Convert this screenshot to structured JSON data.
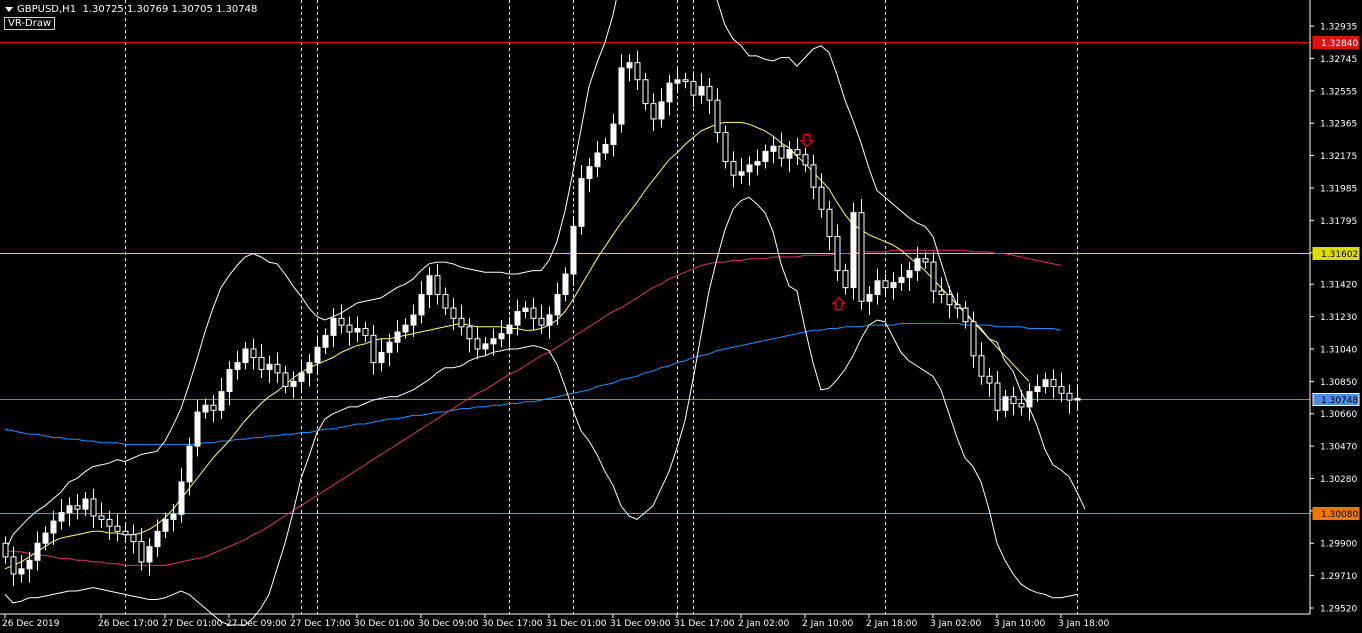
{
  "header": {
    "symbol": "GBPUSD,H1",
    "ohlc": "1.30725 1.30769 1.30705 1.30748",
    "indicator_label": "VR-Draw"
  },
  "colors": {
    "background": "#000000",
    "bull_candle": "#ffffff",
    "bear_candle": "#000000",
    "candle_wick": "#ffffff",
    "bb_line": "#ffffff",
    "ma_yellow": "#ffff66",
    "ma_pink": "#dd3366",
    "ma_blue": "#1e90ff",
    "red_level": "#dd1111",
    "yellow_level": "#dddd00",
    "blue_level": "#4a90e2",
    "orange_level": "#ee7700",
    "arrow": "#dd0000",
    "grid": "#ffffff"
  },
  "chart_data": {
    "type": "candlestick",
    "symbol": "GBPUSD",
    "timeframe": "H1",
    "ylim": [
      1.2952,
      1.33
    ],
    "y_ticks": [
      "1.32935",
      "1.32745",
      "1.32555",
      "1.32365",
      "1.32175",
      "1.31985",
      "1.31795",
      "1.31605",
      "1.31420",
      "1.31230",
      "1.31040",
      "1.30850",
      "1.30660",
      "1.30470",
      "1.30280",
      "1.30090",
      "1.29900",
      "1.29710",
      "1.29520"
    ],
    "x_labels": [
      {
        "bar": 0,
        "label": "26 Dec 2019"
      },
      {
        "bar": 12,
        "label": "26 Dec 17:00"
      },
      {
        "bar": 20,
        "label": "27 Dec 01:00"
      },
      {
        "bar": 28,
        "label": "27 Dec 09:00"
      },
      {
        "bar": 36,
        "label": "27 Dec 17:00"
      },
      {
        "bar": 44,
        "label": "30 Dec 01:00"
      },
      {
        "bar": 52,
        "label": "30 Dec 09:00"
      },
      {
        "bar": 60,
        "label": "30 Dec 17:00"
      },
      {
        "bar": 68,
        "label": "31 Dec 01:00"
      },
      {
        "bar": 76,
        "label": "31 Dec 09:00"
      },
      {
        "bar": 84,
        "label": "31 Dec 17:00"
      },
      {
        "bar": 92,
        "label": "2 Jan 02:00"
      },
      {
        "bar": 100,
        "label": "2 Jan 10:00"
      },
      {
        "bar": 108,
        "label": "2 Jan 18:00"
      },
      {
        "bar": 116,
        "label": "3 Jan 02:00"
      },
      {
        "bar": 124,
        "label": "3 Jan 10:00"
      },
      {
        "bar": 132,
        "label": "3 Jan 18:00"
      }
    ],
    "vlines": [
      15,
      37,
      39,
      63,
      71,
      84,
      86,
      110,
      134
    ],
    "closes": [
      1.2982,
      1.2972,
      1.2975,
      1.298,
      1.299,
      1.2996,
      1.3003,
      1.3008,
      1.3012,
      1.301,
      1.3016,
      1.3006,
      1.3004,
      1.3,
      1.2997,
      1.2995,
      1.2991,
      1.2979,
      1.2988,
      1.2997,
      1.3004,
      1.3007,
      1.3026,
      1.3047,
      1.3067,
      1.3071,
      1.3068,
      1.3079,
      1.3092,
      1.3096,
      1.3104,
      1.3099,
      1.3092,
      1.3095,
      1.309,
      1.3082,
      1.3085,
      1.309,
      1.3096,
      1.3105,
      1.3112,
      1.3122,
      1.3118,
      1.3114,
      1.3116,
      1.3112,
      1.3096,
      1.3102,
      1.3108,
      1.3114,
      1.3118,
      1.3124,
      1.3136,
      1.3147,
      1.3136,
      1.3128,
      1.3122,
      1.3117,
      1.311,
      1.3104,
      1.3107,
      1.311,
      1.3113,
      1.3118,
      1.3126,
      1.3128,
      1.3122,
      1.3118,
      1.3124,
      1.3136,
      1.3148,
      1.3176,
      1.3204,
      1.3211,
      1.3219,
      1.3224,
      1.3236,
      1.3269,
      1.3272,
      1.3262,
      1.3248,
      1.3239,
      1.3249,
      1.326,
      1.3262,
      1.3261,
      1.3253,
      1.3258,
      1.325,
      1.3231,
      1.3214,
      1.3206,
      1.3208,
      1.3212,
      1.3214,
      1.322,
      1.3223,
      1.3216,
      1.3221,
      1.3218,
      1.3212,
      1.3199,
      1.3186,
      1.317,
      1.315,
      1.314,
      1.3184,
      1.3132,
      1.3136,
      1.3144,
      1.314,
      1.3143,
      1.3146,
      1.315,
      1.3157,
      1.3155,
      1.3138,
      1.3136,
      1.313,
      1.3128,
      1.312,
      1.31,
      1.3088,
      1.3084,
      1.3068,
      1.3076,
      1.3072,
      1.307,
      1.3079,
      1.3082,
      1.3086,
      1.3082,
      1.3078,
      1.3074,
      1.3075
    ],
    "bb_upper": [
      1.2985,
      1.2995,
      1.3,
      1.3005,
      1.3009,
      1.3012,
      1.3016,
      1.302,
      1.3026,
      1.3028,
      1.3032,
      1.3035,
      1.3036,
      1.3037,
      1.3039,
      1.3038,
      1.304,
      1.3042,
      1.3043,
      1.3044,
      1.305,
      1.3059,
      1.3069,
      1.3083,
      1.3098,
      1.3114,
      1.3128,
      1.314,
      1.3147,
      1.3153,
      1.3158,
      1.316,
      1.3158,
      1.3155,
      1.3154,
      1.3148,
      1.3141,
      1.3135,
      1.3128,
      1.3123,
      1.3121,
      1.3123,
      1.3125,
      1.3128,
      1.3131,
      1.3132,
      1.3133,
      1.3134,
      1.3137,
      1.314,
      1.3142,
      1.3145,
      1.315,
      1.3154,
      1.3155,
      1.3155,
      1.3154,
      1.3152,
      1.3151,
      1.315,
      1.3149,
      1.3149,
      1.3149,
      1.3148,
      1.3148,
      1.3149,
      1.315,
      1.315,
      1.3156,
      1.3167,
      1.3185,
      1.3208,
      1.3233,
      1.3258,
      1.3272,
      1.3284,
      1.33,
      1.3322,
      1.3333,
      1.3341,
      1.3346,
      1.335,
      1.3351,
      1.3351,
      1.3349,
      1.3344,
      1.3338,
      1.333,
      1.3322,
      1.3309,
      1.3294,
      1.3286,
      1.3282,
      1.3276,
      1.3276,
      1.3274,
      1.3273,
      1.3275,
      1.3275,
      1.327,
      1.3275,
      1.328,
      1.3282,
      1.3278,
      1.3265,
      1.325,
      1.3238,
      1.3225,
      1.321,
      1.3197,
      1.3193,
      1.3189,
      1.3185,
      1.3181,
      1.3178,
      1.3176,
      1.317,
      1.3155,
      1.314,
      1.313,
      1.3126,
      1.312,
      1.3116,
      1.311,
      1.3108,
      1.3097,
      1.3091,
      1.3079,
      1.307,
      1.3059,
      1.3045,
      1.3036,
      1.3033,
      1.3029,
      1.302,
      1.301
    ],
    "bb_lower": [
      1.296,
      1.2955,
      1.2956,
      1.2958,
      1.2958,
      1.2959,
      1.296,
      1.2961,
      1.2962,
      1.2962,
      1.2963,
      1.2964,
      1.2963,
      1.2962,
      1.2961,
      1.296,
      1.2959,
      1.2958,
      1.2957,
      1.2957,
      1.2958,
      1.296,
      1.2962,
      1.296,
      1.2956,
      1.2952,
      1.2948,
      1.2944,
      1.2942,
      1.2942,
      1.2942,
      1.2946,
      1.2952,
      1.296,
      1.2975,
      1.299,
      1.3008,
      1.3028,
      1.3041,
      1.3055,
      1.3063,
      1.3066,
      1.3068,
      1.307,
      1.307,
      1.3072,
      1.3074,
      1.3075,
      1.3076,
      1.3076,
      1.3078,
      1.308,
      1.3083,
      1.3086,
      1.309,
      1.3093,
      1.3093,
      1.3094,
      1.3097,
      1.3099,
      1.31,
      1.3102,
      1.3103,
      1.3104,
      1.3104,
      1.3105,
      1.3106,
      1.3105,
      1.3103,
      1.3095,
      1.3082,
      1.3068,
      1.3056,
      1.305,
      1.3042,
      1.3032,
      1.3024,
      1.3012,
      1.3006,
      1.3004,
      1.3008,
      1.3012,
      1.3022,
      1.3032,
      1.3046,
      1.3062,
      1.3086,
      1.3112,
      1.3138,
      1.3157,
      1.3174,
      1.3186,
      1.3191,
      1.3193,
      1.3189,
      1.3184,
      1.3173,
      1.3154,
      1.3141,
      1.3138,
      1.3116,
      1.3096,
      1.308,
      1.3081,
      1.3086,
      1.3092,
      1.31,
      1.311,
      1.3118,
      1.3121,
      1.312,
      1.3111,
      1.3102,
      1.3097,
      1.3094,
      1.3091,
      1.3088,
      1.308,
      1.3066,
      1.3052,
      1.304,
      1.3035,
      1.3026,
      1.301,
      1.299,
      1.298,
      1.2972,
      1.2966,
      1.2963,
      1.2961,
      1.296,
      1.2958,
      1.2958,
      1.2959,
      1.296
    ],
    "ma_yellow": [
      1.2975,
      1.2977,
      1.2979,
      1.2982,
      1.2985,
      1.2988,
      1.2991,
      1.2993,
      1.2994,
      1.2995,
      1.2996,
      1.2997,
      1.2997,
      1.2996,
      1.2996,
      1.2995,
      1.2995,
      1.2996,
      1.2998,
      1.3001,
      1.3005,
      1.301,
      1.3016,
      1.3022,
      1.3028,
      1.3034,
      1.304,
      1.3045,
      1.305,
      1.3056,
      1.3062,
      1.3067,
      1.3072,
      1.3076,
      1.3079,
      1.3083,
      1.3087,
      1.309,
      1.3093,
      1.3095,
      1.3097,
      1.3099,
      1.3102,
      1.3104,
      1.3106,
      1.3107,
      1.3109,
      1.311,
      1.311,
      1.3111,
      1.3112,
      1.3113,
      1.3114,
      1.3115,
      1.3116,
      1.3117,
      1.3118,
      1.3119,
      1.3118,
      1.3117,
      1.3117,
      1.3117,
      1.3117,
      1.3116,
      1.3116,
      1.3115,
      1.3115,
      1.3116,
      1.3118,
      1.3121,
      1.3126,
      1.3133,
      1.3141,
      1.3149,
      1.3157,
      1.3164,
      1.3171,
      1.3178,
      1.3184,
      1.319,
      1.3197,
      1.3203,
      1.3209,
      1.3215,
      1.3219,
      1.3224,
      1.3228,
      1.3232,
      1.3234,
      1.3236,
      1.3237,
      1.3237,
      1.3237,
      1.3236,
      1.3234,
      1.3232,
      1.3229,
      1.3225,
      1.3222,
      1.3217,
      1.3213,
      1.3208,
      1.3203,
      1.3198,
      1.319,
      1.3183,
      1.3177,
      1.3174,
      1.3171,
      1.3169,
      1.3167,
      1.3165,
      1.3162,
      1.3158,
      1.3154,
      1.315,
      1.3145,
      1.314,
      1.3135,
      1.313,
      1.3125,
      1.312,
      1.3115,
      1.311,
      1.3105,
      1.31,
      1.3095,
      1.309,
      1.3085
    ],
    "ma_pink": [
      1.2986,
      1.2985,
      1.2985,
      1.2984,
      1.2983,
      1.2983,
      1.2982,
      1.2981,
      1.2981,
      1.298,
      1.298,
      1.2979,
      1.2979,
      1.2978,
      1.2978,
      1.2977,
      1.2977,
      1.2977,
      1.2977,
      1.2977,
      1.2977,
      1.2978,
      1.2979,
      1.298,
      1.2981,
      1.2982,
      1.2984,
      1.2986,
      1.2988,
      1.299,
      1.2992,
      1.2995,
      1.2997,
      1.3,
      1.3003,
      1.3006,
      1.3009,
      1.3012,
      1.3015,
      1.3018,
      1.3021,
      1.3024,
      1.3027,
      1.303,
      1.3033,
      1.3036,
      1.3039,
      1.3042,
      1.3045,
      1.3048,
      1.3051,
      1.3054,
      1.3057,
      1.306,
      1.3063,
      1.3066,
      1.3069,
      1.3072,
      1.3075,
      1.3078,
      1.308,
      1.3083,
      1.3086,
      1.3089,
      1.3091,
      1.3094,
      1.3097,
      1.31,
      1.3102,
      1.3105,
      1.3108,
      1.3111,
      1.3114,
      1.3117,
      1.312,
      1.3123,
      1.3126,
      1.3128,
      1.3131,
      1.3134,
      1.3137,
      1.314,
      1.3142,
      1.3145,
      1.3147,
      1.3149,
      1.3151,
      1.3153,
      1.3154,
      1.3155,
      1.3155,
      1.3156,
      1.3156,
      1.3157,
      1.3157,
      1.3157,
      1.3158,
      1.3158,
      1.3158,
      1.3158,
      1.3159,
      1.3159,
      1.3159,
      1.3159,
      1.316,
      1.316,
      1.316,
      1.3161,
      1.3161,
      1.3161,
      1.3161,
      1.3162,
      1.3162,
      1.3162,
      1.3162,
      1.3162,
      1.3162,
      1.3162,
      1.3162,
      1.3162,
      1.3162,
      1.3161,
      1.3161,
      1.3161,
      1.316,
      1.316,
      1.3159,
      1.3158,
      1.3157,
      1.3156,
      1.3155,
      1.3154,
      1.3153
    ],
    "ma_blue": [
      1.3057,
      1.3056,
      1.3055,
      1.3054,
      1.3054,
      1.3053,
      1.3052,
      1.3052,
      1.3051,
      1.3051,
      1.305,
      1.305,
      1.3049,
      1.3049,
      1.3049,
      1.3048,
      1.3048,
      1.3048,
      1.3048,
      1.3048,
      1.3048,
      1.3048,
      1.3048,
      1.3048,
      1.3048,
      1.3049,
      1.3049,
      1.305,
      1.305,
      1.3051,
      1.3051,
      1.3052,
      1.3052,
      1.3053,
      1.3053,
      1.3054,
      1.3054,
      1.3055,
      1.3055,
      1.3056,
      1.3057,
      1.3057,
      1.3058,
      1.3059,
      1.306,
      1.306,
      1.3061,
      1.3062,
      1.3063,
      1.3063,
      1.3064,
      1.3065,
      1.3065,
      1.3066,
      1.3067,
      1.3067,
      1.3068,
      1.3069,
      1.3069,
      1.307,
      1.307,
      1.3071,
      1.3071,
      1.3072,
      1.3072,
      1.3073,
      1.3073,
      1.3074,
      1.3075,
      1.3076,
      1.3077,
      1.3078,
      1.3079,
      1.308,
      1.3082,
      1.3083,
      1.3084,
      1.3086,
      1.3087,
      1.3088,
      1.309,
      1.3091,
      1.3093,
      1.3094,
      1.3096,
      1.3097,
      1.3099,
      1.31,
      1.3101,
      1.3103,
      1.3104,
      1.3105,
      1.3106,
      1.3107,
      1.3108,
      1.3109,
      1.311,
      1.3111,
      1.3112,
      1.3113,
      1.3114,
      1.3115,
      1.3115,
      1.3116,
      1.3116,
      1.3117,
      1.3117,
      1.3117,
      1.3118,
      1.3118,
      1.3118,
      1.3118,
      1.3119,
      1.3119,
      1.3119,
      1.3119,
      1.3119,
      1.3119,
      1.3119,
      1.3119,
      1.3118,
      1.3118,
      1.3118,
      1.3118,
      1.3117,
      1.3117,
      1.3117,
      1.3117,
      1.3116,
      1.3116,
      1.3116,
      1.3116,
      1.3115
    ],
    "levels": [
      {
        "name": "red",
        "price": 1.3284,
        "label": "1.32840",
        "color": "#dd1111",
        "label_text": "#ffffff"
      },
      {
        "name": "yellow",
        "price": 1.31602,
        "label": "1.31602",
        "color": "#dddd00",
        "label_text": "#000000"
      },
      {
        "name": "blue",
        "price": 1.30748,
        "label": "1.30748",
        "color": "#4a90e2",
        "label_text": "#000000"
      },
      {
        "name": "orange",
        "price": 1.3008,
        "label": "1.30080",
        "color": "#ee7700",
        "label_text": "#000000"
      }
    ],
    "arrows": [
      {
        "bar": 100,
        "price": 1.3224,
        "direction": "down"
      },
      {
        "bar": 104,
        "price": 1.3133,
        "direction": "up"
      }
    ]
  }
}
